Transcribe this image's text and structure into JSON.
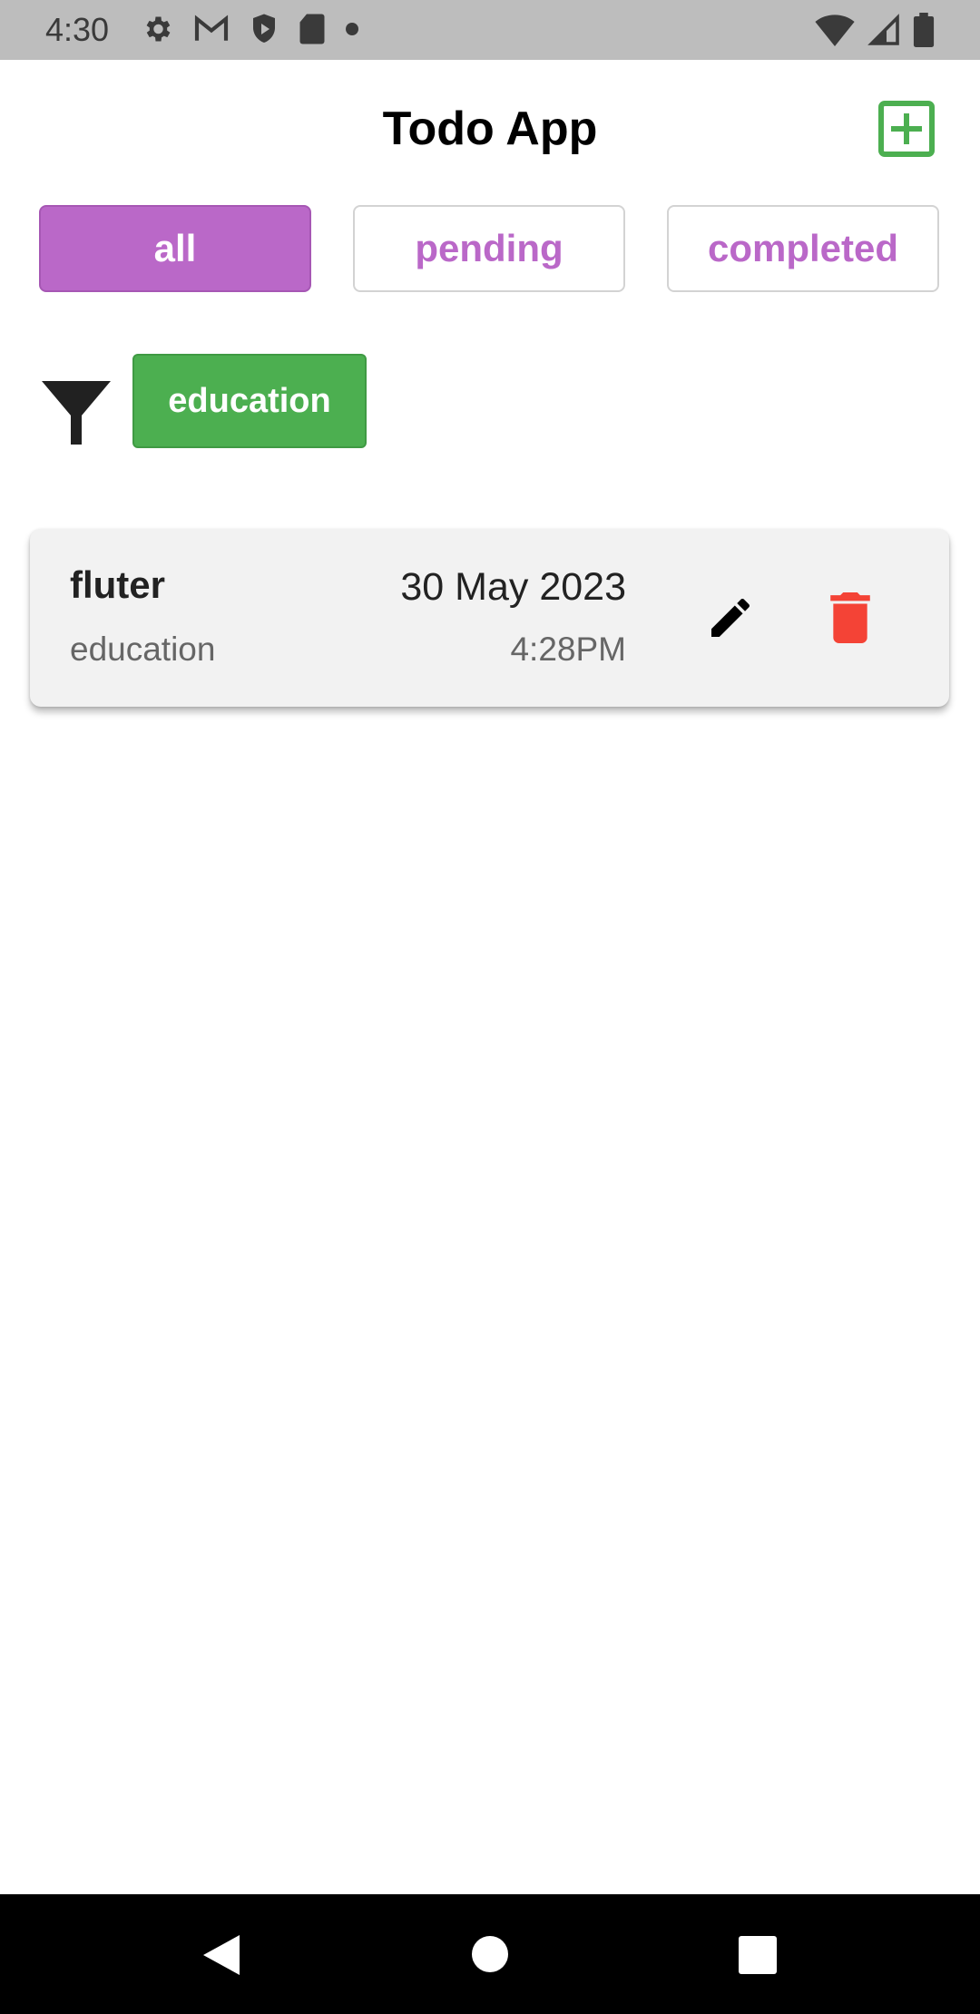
{
  "status_bar": {
    "time": "4:30",
    "icons_left": [
      "settings-icon",
      "gmail-icon",
      "shield-icon",
      "sd-card-icon",
      "dot-icon"
    ],
    "icons_right": [
      "wifi-icon",
      "signal-icon",
      "battery-icon"
    ]
  },
  "header": {
    "title": "Todo App",
    "add_icon": "add-box-icon",
    "accent_color": "#4caf50"
  },
  "tabs": [
    {
      "label": "all",
      "active": true
    },
    {
      "label": "pending",
      "active": false
    },
    {
      "label": "completed",
      "active": false
    }
  ],
  "tab_color": "#ba68c8",
  "filter": {
    "icon": "filter-icon",
    "chip_label": "education"
  },
  "todos": [
    {
      "title": "fluter",
      "category": "education",
      "date": "30 May 2023",
      "time": "4:28PM",
      "edit_icon": "edit-icon",
      "delete_icon": "delete-icon",
      "delete_color": "#f44336"
    }
  ],
  "nav_bar": {
    "icons": [
      "back-icon",
      "home-icon",
      "recents-icon"
    ]
  }
}
